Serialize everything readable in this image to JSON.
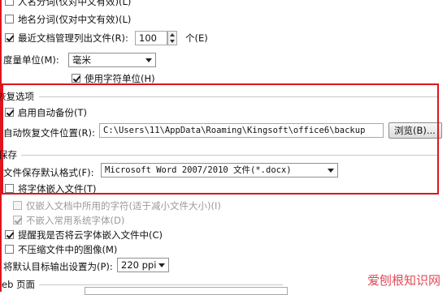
{
  "rows": {
    "person_name": "人名分词(仅对中文有效)(L)",
    "place_name": "地名分词(仅对中文有效)(L)",
    "recent_docs_label": "最近文档管理列出文件(R):",
    "recent_docs_value": "100",
    "recent_docs_unit": "个(E)",
    "measure_label": "度量单位(M):",
    "measure_value": "毫米",
    "char_unit": "使用字符单位(H)"
  },
  "recovery": {
    "section_title": "恢复选项",
    "auto_backup": "启用自动备份(T)",
    "auto_recover_label": "自动恢复文件位置(R):",
    "auto_recover_path": "C:\\Users\\11\\AppData\\Roaming\\Kingsoft\\office6\\backup",
    "browse_label": "浏览(B)..."
  },
  "save": {
    "section_title": "保存",
    "format_label": "文件保存默认格式(F):",
    "format_value": "Microsoft Word 2007/2010 文件(*.docx)",
    "embed_fonts": "将字体嵌入文件(T)",
    "embed_used_only": "仅嵌入文档中所用的字符(适于减小文件大小)(I)",
    "no_common_fonts": "不嵌入常用系统字体(D)",
    "remind_cloud_fonts": "提醒我是否将云字体嵌入文件中(C)",
    "no_compress_images": "不压缩文件中的图像(M)",
    "default_target_label": "将默认目标输出设置为(P):",
    "default_target_value": "220 ppi"
  },
  "web": {
    "section_title": "eb 页面"
  },
  "watermark": "爱刨根知识网",
  "colors": {
    "highlight": "#e0141e"
  }
}
